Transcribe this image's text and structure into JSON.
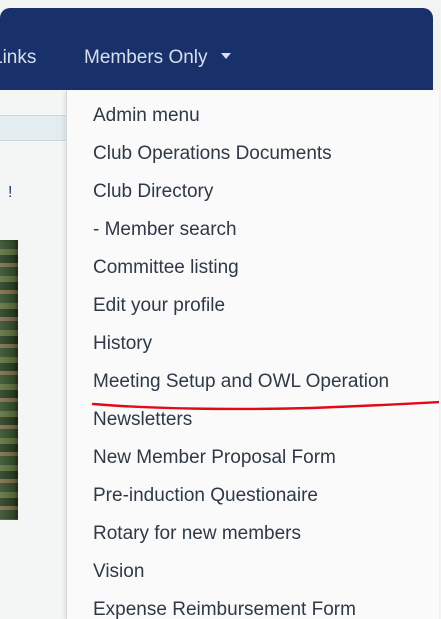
{
  "navbar": {
    "left_item_label": "Links",
    "members_label": "Members Only"
  },
  "left": {
    "mark": "!"
  },
  "dropdown": {
    "items": [
      "Admin menu",
      "Club Operations Documents",
      "Club Directory",
      "- Member search",
      "Committee listing",
      "Edit your profile",
      "History",
      "Meeting Setup and OWL Operation",
      "Newsletters",
      "New Member Proposal Form",
      "Pre-induction Questionaire",
      "Rotary for new members",
      "Vision",
      "Expense Reimbursement Form"
    ]
  },
  "colors": {
    "navbar": "#19316a",
    "dropdown_text": "#2f3946",
    "annotation": "#e10b17"
  }
}
